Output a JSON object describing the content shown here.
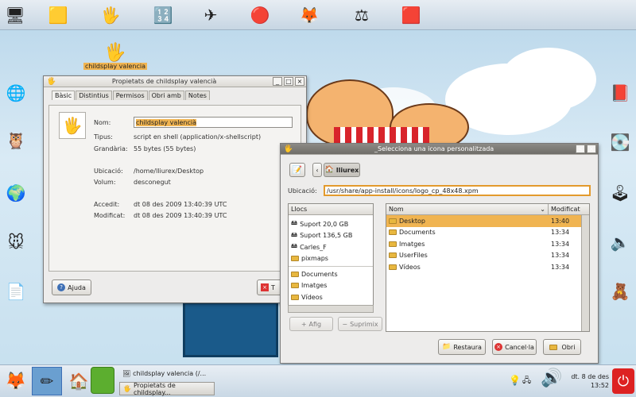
{
  "desktop": {
    "icon_label": "childsplay valencia",
    "top_icons": [
      "tux-icon",
      "hand-icon",
      "numbers-icon",
      "plane-icon",
      "beads-icon",
      "fox-icon",
      "balance-icon",
      "blocks-icon"
    ],
    "left_icons": [
      "firefox-icon",
      "owl-icon",
      "globe-icon",
      "mouse-icon",
      "document-icon"
    ],
    "right_icons": [
      "book-icon",
      "drive-icon",
      "joystick-icon",
      "speaker-icon",
      "bear-icon"
    ]
  },
  "props": {
    "title": "Propietats de childsplay valencià",
    "tabs": [
      "Bàsic",
      "Distintius",
      "Permisos",
      "Obri amb",
      "Notes"
    ],
    "name_label": "Nom:",
    "name_value": "childsplay valencià",
    "type_label": "Tipus:",
    "type_value": "script en shell (application/x-shellscript)",
    "size_label": "Grandària:",
    "size_value": "55 bytes (55 bytes)",
    "location_label": "Ubicació:",
    "location_value": "/home/lliurex/Desktop",
    "volume_label": "Volum:",
    "volume_value": "desconegut",
    "accessed_label": "Accedit:",
    "accessed_value": "dt 08 des 2009 13:40:39 UTC",
    "modified_label": "Modificat:",
    "modified_value": "dt 08 des 2009 13:40:39 UTC",
    "help_label": "Ajuda",
    "close_partial": "T"
  },
  "chooser": {
    "title": "_Selecciona una icona personalitzada",
    "path_button": "lliurex",
    "location_label": "Ubicació:",
    "location_value": "/usr/share/app-install/icons/logo_cp_48x48.xpm",
    "places_header": "Llocs",
    "places": [
      {
        "label": "Suport 20,0 GB",
        "icon": "drive"
      },
      {
        "label": "Suport 136,5 GB",
        "icon": "drive"
      },
      {
        "label": "Carles_F",
        "icon": "drive"
      },
      {
        "label": "pixmaps",
        "icon": "folder"
      },
      {
        "label": "Documents",
        "icon": "folder"
      },
      {
        "label": "Imatges",
        "icon": "folder"
      },
      {
        "label": "Vídeos",
        "icon": "folder"
      }
    ],
    "add_label": "Afig",
    "remove_label": "Suprimix",
    "col_name": "Nom",
    "col_modified": "Modificat",
    "files": [
      {
        "name": "Desktop",
        "modified": "13:40",
        "selected": true
      },
      {
        "name": "Documents",
        "modified": "13:34"
      },
      {
        "name": "Imatges",
        "modified": "13:34"
      },
      {
        "name": "UserFiles",
        "modified": "13:34"
      },
      {
        "name": "Vídeos",
        "modified": "13:34"
      }
    ],
    "restore_label": "Restaura",
    "cancel_label": "Cancel·la",
    "open_label": "Obri"
  },
  "taskbar": {
    "items": [
      "childsplay valencia (/...",
      "Propietats de childsplay..."
    ],
    "clock_line1": "dt. 8 de des",
    "clock_line2": "13:52"
  },
  "colors": {
    "selection": "#f0b451",
    "accent_orange": "#e8b73f"
  }
}
